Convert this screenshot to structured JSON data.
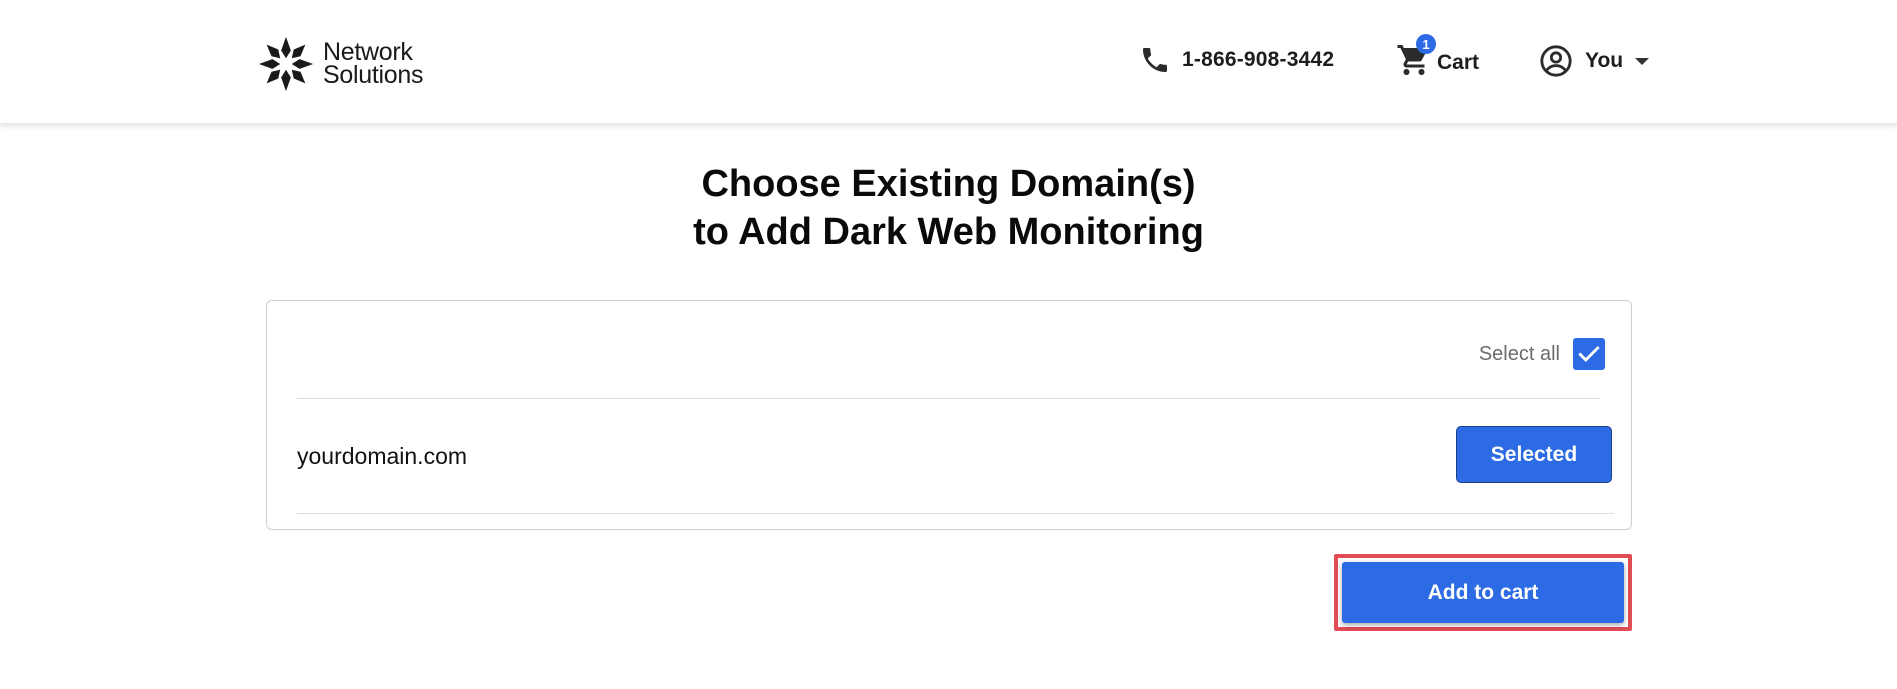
{
  "header": {
    "logo": {
      "line1": "Network",
      "line2": "Solutions",
      "icon": "network-solutions-logo-icon"
    },
    "phone": {
      "number": "1-866-908-3442",
      "icon": "phone-icon"
    },
    "cart": {
      "label": "Cart",
      "count": "1",
      "icon": "cart-icon"
    },
    "user": {
      "label": "You",
      "icon": "user-circle-icon",
      "dropdown_icon": "caret-down-icon"
    }
  },
  "main": {
    "title_line1": "Choose Existing Domain(s)",
    "title_line2": "to Add Dark Web Monitoring",
    "select_all": {
      "label": "Select all",
      "checked": true
    },
    "domains": [
      {
        "name": "yourdomain.com",
        "button_label": "Selected"
      }
    ],
    "add_to_cart_label": "Add to cart"
  },
  "colors": {
    "accent": "#2d6be4",
    "highlight": "#e24c55"
  }
}
